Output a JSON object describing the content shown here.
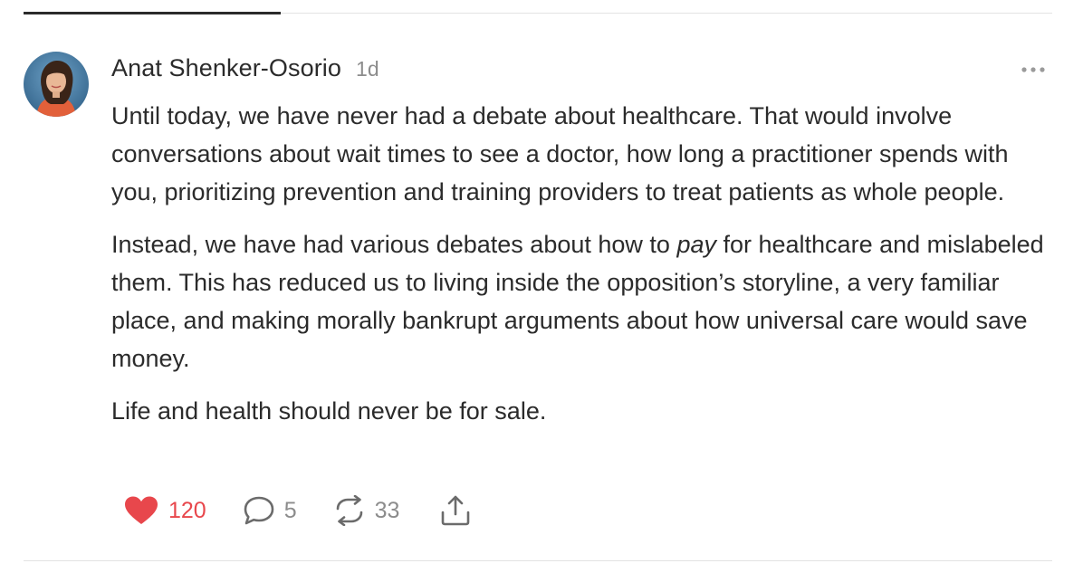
{
  "note": {
    "author": "Anat Shenker-Osorio",
    "time": "1d",
    "paragraphs": {
      "p1": "Until today, we have never had a debate about healthcare. That would involve conversations about wait times to see a doctor, how long a practitioner spends with you, prioritizing prevention and training providers to treat patients as whole people.",
      "p2_before": "Instead, we have had various debates about how to ",
      "p2_emphasis": "pay",
      "p2_after": " for healthcare and mislabeled them. This has reduced us to living inside the opposition’s storyline, a very familiar place, and making morally bankrupt arguments about how universal care would save money.",
      "p3": "Life and health should never be for sale."
    }
  },
  "actions": {
    "likes": "120",
    "comments": "5",
    "restacks": "33"
  },
  "icons": {
    "like": "heart-icon",
    "comment": "speech-bubble-icon",
    "restack": "restack-arrows-icon",
    "share": "share-upload-icon",
    "more": "ellipsis-icon"
  },
  "colors": {
    "like_red": "#e8474c",
    "muted": "#8c8c8c",
    "text": "#2b2b2b"
  }
}
